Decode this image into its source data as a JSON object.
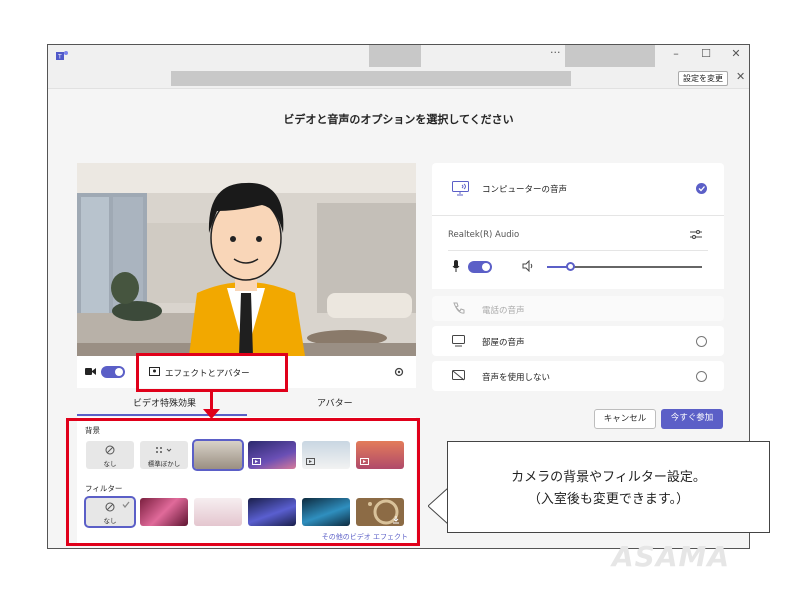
{
  "titlebar": {
    "ellipsis": "···",
    "minimize": "–",
    "maximize": "☐",
    "close": "✕"
  },
  "addressbar": {
    "settings_label": "設定を変更",
    "close": "✕"
  },
  "heading": "ビデオと音声のオプションを選択してください",
  "video": {
    "effects_avatar_label": "エフェクトとアバター",
    "tab_effects": "ビデオ特殊効果",
    "tab_avatar": "アバター",
    "background_label": "背景",
    "none_label": "なし",
    "blur_label": "標準ぼかし",
    "filter_label": "フィルター",
    "filter_none_label": "なし",
    "more_effects_link": "その他のビデオ エフェクト"
  },
  "audio": {
    "computer_audio": "コンピューターの音声",
    "device_name": "Realtek(R) Audio",
    "phone_audio": "電話の音声",
    "room_audio": "部屋の音声",
    "no_audio": "音声を使用しない",
    "volume": 0.15
  },
  "buttons": {
    "cancel": "キャンセル",
    "join_now": "今すぐ参加"
  },
  "callout": {
    "line1": "カメラの背景やフィルター設定。",
    "line2": "（入室後も変更できます。）"
  },
  "watermark": "ASAMA",
  "colors": {
    "accent": "#5b5fc7",
    "highlight": "#e0001a"
  }
}
